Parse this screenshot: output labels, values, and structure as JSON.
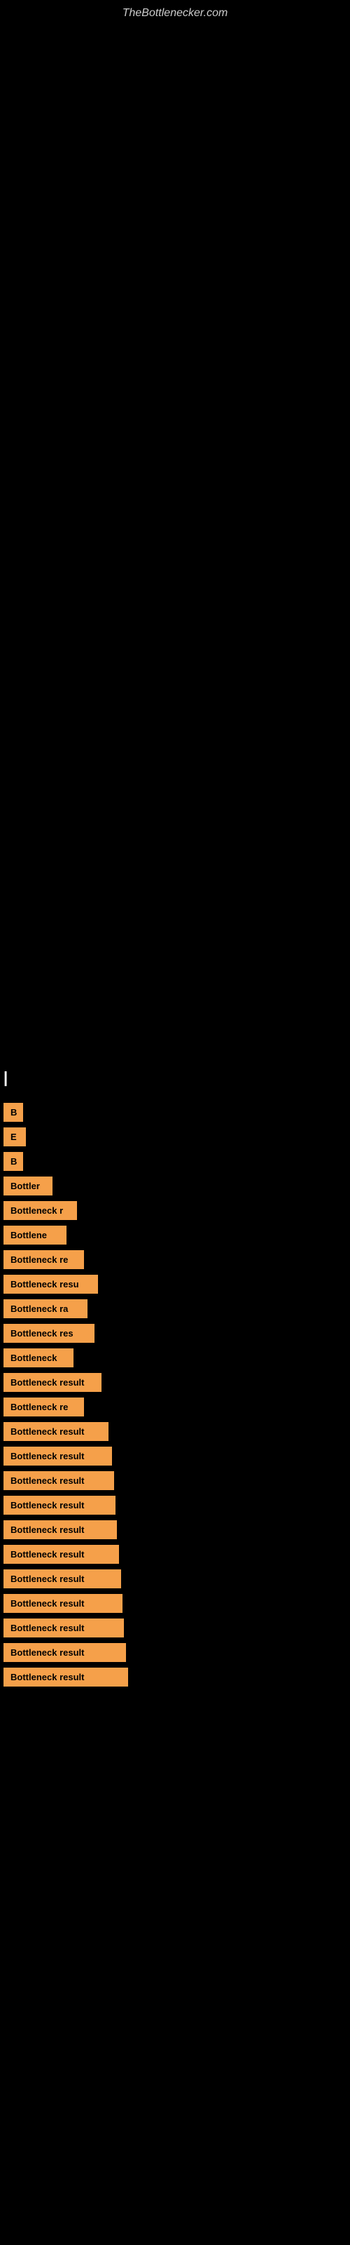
{
  "site": {
    "title": "TheBottlenecker.com"
  },
  "label": {
    "text": "|"
  },
  "items": [
    {
      "id": 1,
      "text": "B",
      "width_class": "item-w1"
    },
    {
      "id": 2,
      "text": "E",
      "width_class": "item-w2"
    },
    {
      "id": 3,
      "text": "B",
      "width_class": "item-w3"
    },
    {
      "id": 4,
      "text": "Bottler",
      "width_class": "item-w4"
    },
    {
      "id": 5,
      "text": "Bottleneck r",
      "width_class": "item-w5"
    },
    {
      "id": 6,
      "text": "Bottlene",
      "width_class": "item-w6"
    },
    {
      "id": 7,
      "text": "Bottleneck re",
      "width_class": "item-w7"
    },
    {
      "id": 8,
      "text": "Bottleneck resu",
      "width_class": "item-w8"
    },
    {
      "id": 9,
      "text": "Bottleneck ra",
      "width_class": "item-w9"
    },
    {
      "id": 10,
      "text": "Bottleneck res",
      "width_class": "item-w10"
    },
    {
      "id": 11,
      "text": "Bottleneck",
      "width_class": "item-w11"
    },
    {
      "id": 12,
      "text": "Bottleneck result",
      "width_class": "item-w12"
    },
    {
      "id": 13,
      "text": "Bottleneck re",
      "width_class": "item-w13"
    },
    {
      "id": 14,
      "text": "Bottleneck result",
      "width_class": "item-w14"
    },
    {
      "id": 15,
      "text": "Bottleneck result",
      "width_class": "item-w15"
    },
    {
      "id": 16,
      "text": "Bottleneck result",
      "width_class": "item-w16"
    },
    {
      "id": 17,
      "text": "Bottleneck result",
      "width_class": "item-w17"
    },
    {
      "id": 18,
      "text": "Bottleneck result",
      "width_class": "item-w18"
    },
    {
      "id": 19,
      "text": "Bottleneck result",
      "width_class": "item-w19"
    },
    {
      "id": 20,
      "text": "Bottleneck result",
      "width_class": "item-w20"
    },
    {
      "id": 21,
      "text": "Bottleneck result",
      "width_class": "item-w21"
    },
    {
      "id": 22,
      "text": "Bottleneck result",
      "width_class": "item-w22"
    },
    {
      "id": 23,
      "text": "Bottleneck result",
      "width_class": "item-w23"
    },
    {
      "id": 24,
      "text": "Bottleneck result",
      "width_class": "item-w24"
    }
  ]
}
